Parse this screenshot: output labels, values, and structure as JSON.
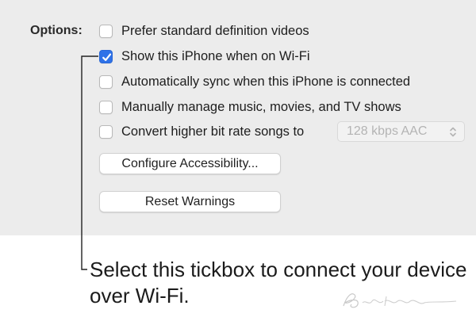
{
  "options": {
    "label": "Options:",
    "items": [
      {
        "label": "Prefer standard definition videos",
        "checked": false
      },
      {
        "label": "Show this iPhone when on Wi-Fi",
        "checked": true
      },
      {
        "label": "Automatically sync when this iPhone is connected",
        "checked": false
      },
      {
        "label": "Manually manage music, movies, and TV shows",
        "checked": false
      },
      {
        "label": "Convert higher bit rate songs to",
        "checked": false
      }
    ],
    "bitrate_select": {
      "value": "128 kbps AAC",
      "enabled": false
    }
  },
  "buttons": {
    "configure_accessibility": "Configure Accessibility...",
    "reset_warnings": "Reset Warnings"
  },
  "callout": {
    "text": "Select this tickbox to connect your device over Wi-Fi."
  },
  "colors": {
    "panel_bg": "#ececec",
    "checkbox_checked": "#2f72e8",
    "callout_line": "#222222"
  },
  "icons": {
    "checkmark": "checkmark-icon",
    "select_arrows": "chevron-up-down-icon",
    "signature": "signature-icon"
  }
}
